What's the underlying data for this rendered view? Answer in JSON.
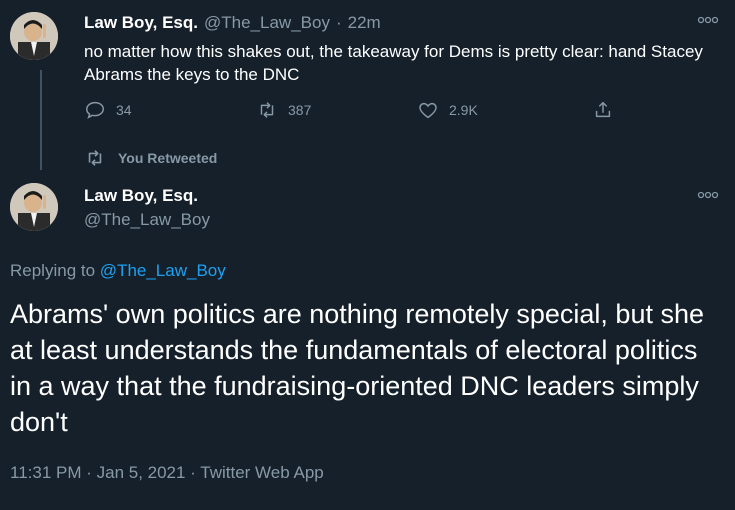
{
  "tweet1": {
    "name": "Law Boy, Esq.",
    "handle": "@The_Law_Boy",
    "separator": "·",
    "time": "22m",
    "more_icon": "more-dots-icon",
    "text": "no matter how this shakes out, the takeaway for Dems is pretty clear: hand Stacey Abrams the keys to the DNC",
    "actions": {
      "reply_count": "34",
      "retweet_count": "387",
      "like_count": "2.9K"
    }
  },
  "retweet_banner": {
    "label": "You Retweeted",
    "icon": "retweet-icon"
  },
  "tweet2": {
    "name": "Law Boy, Esq.",
    "handle": "@The_Law_Boy",
    "more_icon": "more-dots-icon",
    "replying_prefix": "Replying to",
    "replying_to": "@The_Law_Boy",
    "text": "Abrams' own politics are nothing remotely special, but she at least understands the fundamentals of electoral politics in a way that the fundraising-oriented DNC leaders simply don't",
    "meta": "11:31 PM · Jan 5, 2021 · Twitter Web App"
  },
  "colors": {
    "background": "#15202b",
    "muted": "#8899a6",
    "link": "#1da1f2"
  }
}
